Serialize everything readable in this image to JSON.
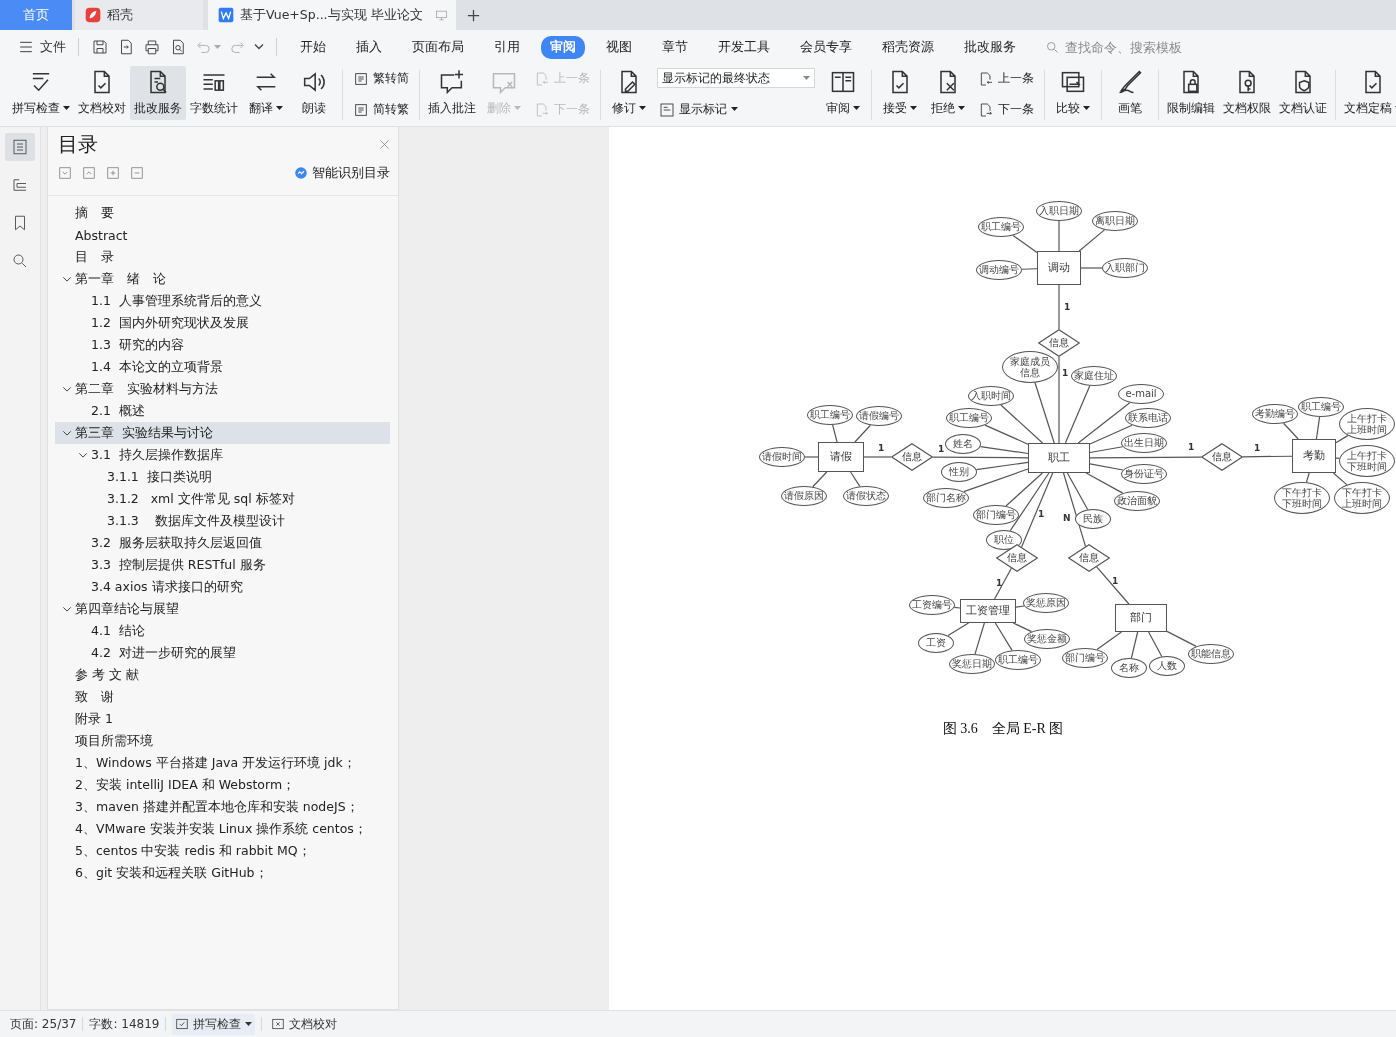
{
  "tabs": [
    {
      "label": "首页",
      "kind": "home",
      "selected": false
    },
    {
      "label": "稻壳",
      "kind": "docer",
      "selected": false
    },
    {
      "label": "基于Vue+Sp...与实现 毕业论文",
      "kind": "document",
      "selected": true
    }
  ],
  "menu": {
    "file": "文件",
    "tabs": [
      {
        "label": "开始",
        "selected": false
      },
      {
        "label": "插入",
        "selected": false
      },
      {
        "label": "页面布局",
        "selected": false
      },
      {
        "label": "引用",
        "selected": false
      },
      {
        "label": "审阅",
        "selected": true
      },
      {
        "label": "视图",
        "selected": false
      },
      {
        "label": "章节",
        "selected": false
      },
      {
        "label": "开发工具",
        "selected": false
      },
      {
        "label": "会员专享",
        "selected": false
      },
      {
        "label": "稻壳资源",
        "selected": false
      },
      {
        "label": "批改服务",
        "selected": false
      }
    ],
    "search": {
      "placeholder": "查找命令、搜索模板"
    }
  },
  "ribbon": [
    [
      {
        "label": "拼写检查",
        "kind": "large",
        "menu": true,
        "disabled": false,
        "highlighted": false
      },
      {
        "label": "文档校对",
        "kind": "large",
        "menu": false,
        "disabled": false,
        "highlighted": false
      },
      {
        "label": "批改服务",
        "kind": "large",
        "menu": false,
        "disabled": false,
        "highlighted": true
      },
      {
        "label": "字数统计",
        "kind": "large",
        "menu": false,
        "disabled": false,
        "highlighted": false
      },
      {
        "label": "翻译",
        "kind": "large",
        "menu": true,
        "disabled": false,
        "highlighted": false
      },
      {
        "label": "朗读",
        "kind": "large",
        "menu": false,
        "disabled": false,
        "highlighted": false
      }
    ],
    [
      {
        "label": "繁转简",
        "kind": "small",
        "menu": false,
        "disabled": false,
        "highlighted": false
      },
      {
        "label": "简转繁",
        "kind": "small",
        "menu": false,
        "disabled": false,
        "highlighted": false
      }
    ],
    [
      {
        "label": "插入批注",
        "kind": "large",
        "menu": false,
        "disabled": false,
        "highlighted": false
      },
      {
        "label": "删除",
        "kind": "large",
        "menu": true,
        "disabled": true,
        "highlighted": false
      },
      {
        "label": "上一条",
        "kind": "small",
        "menu": false,
        "disabled": true,
        "highlighted": false
      },
      {
        "label": "下一条",
        "kind": "small",
        "menu": false,
        "disabled": true,
        "highlighted": false
      }
    ],
    [
      {
        "label": "修订",
        "kind": "large",
        "menu": true,
        "disabled": false,
        "highlighted": false
      },
      {
        "value": "显示标记的最终状态",
        "kind": "select"
      },
      {
        "label": "显示标记",
        "kind": "small",
        "menu": true,
        "disabled": false,
        "highlighted": false
      },
      {
        "label": "审阅",
        "kind": "large",
        "menu": true,
        "disabled": false,
        "highlighted": false
      }
    ],
    [
      {
        "label": "接受",
        "kind": "large",
        "menu": true,
        "disabled": false,
        "highlighted": false
      },
      {
        "label": "拒绝",
        "kind": "large",
        "menu": true,
        "disabled": false,
        "highlighted": false
      },
      {
        "label": "上一条",
        "kind": "small",
        "menu": false,
        "disabled": false,
        "highlighted": false
      },
      {
        "label": "下一条",
        "kind": "small",
        "menu": false,
        "disabled": false,
        "highlighted": false
      }
    ],
    [
      {
        "label": "比较",
        "kind": "large",
        "menu": true,
        "disabled": false,
        "highlighted": false
      }
    ],
    [
      {
        "label": "画笔",
        "kind": "large",
        "menu": false,
        "disabled": false,
        "highlighted": false
      }
    ],
    [
      {
        "label": "限制编辑",
        "kind": "large",
        "menu": false,
        "disabled": false,
        "highlighted": false
      },
      {
        "label": "文档权限",
        "kind": "large",
        "menu": false,
        "disabled": false,
        "highlighted": false
      },
      {
        "label": "文档认证",
        "kind": "large",
        "menu": false,
        "disabled": false,
        "highlighted": false
      }
    ],
    [
      {
        "label": "文档定稿",
        "kind": "large",
        "menu": true,
        "disabled": false,
        "highlighted": false
      }
    ]
  ],
  "rail": [
    {
      "selected": true
    },
    {
      "selected": false
    },
    {
      "selected": false
    },
    {
      "selected": false
    }
  ],
  "toc": {
    "title": "目录",
    "smart_button": "智能识别目录",
    "items": [
      {
        "label": "摘　要",
        "selected": false
      },
      {
        "label": "Abstract",
        "selected": false
      },
      {
        "label": "目　录",
        "selected": false
      },
      {
        "label": "第一章　绪　论",
        "selected": false,
        "expanded": true,
        "children": [
          {
            "label": "1.1  人事管理系统背后的意义",
            "selected": false
          },
          {
            "label": "1.2  国内外研究现状及发展",
            "selected": false
          },
          {
            "label": "1.3  研究的内容",
            "selected": false
          },
          {
            "label": "1.4  本论文的立项背景",
            "selected": false
          }
        ]
      },
      {
        "label": "第二章　实验材料与方法",
        "selected": false,
        "expanded": true,
        "children": [
          {
            "label": "2.1  概述",
            "selected": false
          }
        ]
      },
      {
        "label": "第三章  实验结果与讨论",
        "selected": true,
        "expanded": true,
        "children": [
          {
            "label": "3.1  持久层操作数据库",
            "selected": false,
            "expanded": true,
            "children": [
              {
                "label": "3.1.1  接口类说明",
                "selected": false
              },
              {
                "label": "3.1.2   xml 文件常见 sql 标签对",
                "selected": false
              },
              {
                "label": "3.1.3    数据库文件及模型设计",
                "selected": false
              }
            ]
          },
          {
            "label": "3.2  服务层获取持久层返回值",
            "selected": false
          },
          {
            "label": "3.3  控制层提供 RESTful 服务",
            "selected": false
          },
          {
            "label": "3.4 axios 请求接口的研究",
            "selected": false
          }
        ]
      },
      {
        "label": "第四章结论与展望",
        "selected": false,
        "expanded": true,
        "children": [
          {
            "label": "4.1  结论",
            "selected": false
          },
          {
            "label": "4.2  对进一步研究的展望",
            "selected": false
          }
        ]
      },
      {
        "label": "参 考 文 献",
        "selected": false
      },
      {
        "label": "致　谢",
        "selected": false
      },
      {
        "label": "附录 1",
        "selected": false
      },
      {
        "label": "项目所需环境",
        "selected": false
      },
      {
        "label": "1、Windows 平台搭建 Java 开发运行环境 jdk；",
        "selected": false
      },
      {
        "label": "2、安装 intelliJ IDEA 和 Webstorm；",
        "selected": false
      },
      {
        "label": "3、maven 搭建并配置本地仓库和安装 nodeJS；",
        "selected": false
      },
      {
        "label": "4、VMware 安装并安装 Linux 操作系统 centos；",
        "selected": false
      },
      {
        "label": "5、centos 中安装 redis 和 rabbit MQ；",
        "selected": false
      },
      {
        "label": "6、git 安装和远程关联 GitHub；",
        "selected": false
      }
    ]
  },
  "figure": {
    "entities": [
      {
        "name": "调动",
        "attributes": [
          "职工编号",
          "入职日期",
          "离职日期",
          "调动编号",
          "入职部门"
        ]
      },
      {
        "name": "请假",
        "attributes": [
          "职工编号",
          "请假编号",
          "请假时间",
          "请假原因",
          "请假状态"
        ]
      },
      {
        "name": "职工",
        "attributes": [
          "家庭成员信息",
          "家庭住址",
          "e-mail",
          "入职时间",
          "职工编号",
          "联系电话",
          "姓名",
          "出生日期",
          "性别",
          "身份证号",
          "部门名称",
          "政治面貌",
          "部门编号",
          "民族",
          "职位"
        ]
      },
      {
        "name": "考勤",
        "attributes": [
          "考勤编号",
          "职工编号",
          "上午打卡上班时间",
          "上午打卡下班时间",
          "下午打卡下班时间",
          "下午打卡上班时间"
        ]
      },
      {
        "name": "工资管理",
        "attributes": [
          "工资编号",
          "奖惩原因",
          "工资",
          "奖惩金额",
          "奖惩日期",
          "职工编号"
        ]
      },
      {
        "name": "部门",
        "attributes": [
          "部门编号",
          "名称",
          "人数",
          "职能信息"
        ]
      }
    ],
    "relations": [
      {
        "name": "信息",
        "cardinalities": [
          "1",
          "1"
        ]
      },
      {
        "name": "信息",
        "cardinalities": [
          "1",
          "1"
        ]
      },
      {
        "name": "信息",
        "cardinalities": [
          "1",
          "1"
        ]
      },
      {
        "name": "信息",
        "cardinalities": [
          "1",
          "1"
        ]
      },
      {
        "name": "信息",
        "cardinalities": [
          "N",
          "1"
        ]
      }
    ],
    "caption": "图 3.6　全局 E-R 图"
  },
  "status": {
    "page": "页面: 25/37",
    "words": "字数: 14819",
    "spellcheck": "拼写检查",
    "proofread": "文档校对"
  }
}
